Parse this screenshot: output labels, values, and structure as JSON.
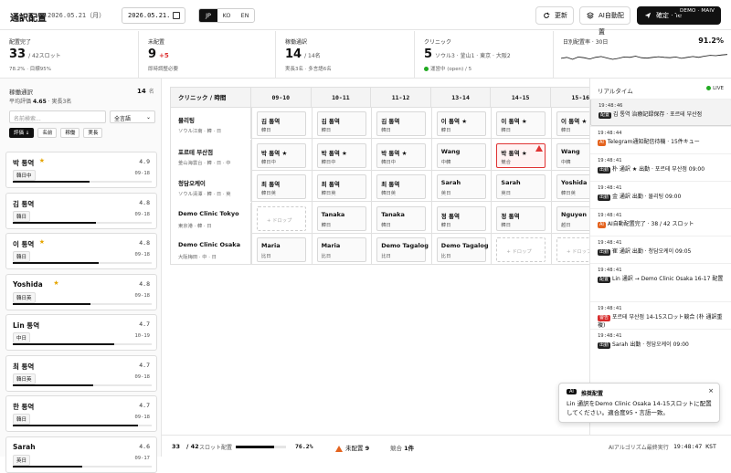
{
  "header": {
    "title": "通訳配置",
    "date_text": "2026.05.21（月）",
    "date_input": "2026.05.21.",
    "langs": [
      "JP",
      "KO",
      "EN"
    ],
    "refresh": "更新",
    "ai_assign": "AI自動配置",
    "confirm": "確定 · Te",
    "demo": "DEMO · MAIV"
  },
  "stats": [
    {
      "label": "配置完了",
      "value": "33",
      "suffix": "/ 42スロット",
      "sub": "78.2% · 目標95%"
    },
    {
      "label": "未配置",
      "value": "9",
      "delta": "+5",
      "sub": "即時調整必要"
    },
    {
      "label": "稼働通訳",
      "value": "14",
      "suffix": "/ 14名",
      "sub": "実長3名 · 多言語6名"
    },
    {
      "label": "クリニック",
      "value": "5",
      "suffix": "ソウル3 · 釜山1 · 東京 · 大阪2",
      "sub": "運営中 (open) / 5"
    },
    {
      "label": "日別配置率 · 30日",
      "value": "91.2%",
      "spark": [
        0.55,
        0.6,
        0.5,
        0.62,
        0.58,
        0.52,
        0.6,
        0.64,
        0.57,
        0.5,
        0.55,
        0.62,
        0.6,
        0.66,
        0.58,
        0.56,
        0.6,
        0.63,
        0.6,
        0.58,
        0.62,
        0.55,
        0.6,
        0.64,
        0.6,
        0.66,
        0.7,
        0.68,
        0.72,
        0.74
      ]
    }
  ],
  "left": {
    "heading": "稼働通訳",
    "count": "14",
    "count_unit": "名",
    "avg_label": "平均評価",
    "avg": "4.65",
    "avg_suffix": "· 実長3名",
    "search_placeholder": "名前検索...",
    "filter": "全言語",
    "sort": [
      "評価",
      "名前",
      "稼働",
      "実長"
    ],
    "interpreters": [
      {
        "name": "박 통역",
        "star": true,
        "score": "4.9",
        "tag": "韓日中",
        "time": "09-18",
        "load": 0.55
      },
      {
        "name": "김 통역",
        "star": false,
        "score": "4.8",
        "tag": "韓日",
        "time": "09-18",
        "load": 0.6
      },
      {
        "name": "이 통역",
        "star": true,
        "score": "4.8",
        "tag": "韓日",
        "time": "09-18",
        "load": 0.62
      },
      {
        "name": "Yoshida",
        "star": true,
        "score": "4.8",
        "tag": "韓日英",
        "time": "09-18",
        "load": 0.56
      },
      {
        "name": "Lin 통역",
        "star": false,
        "score": "4.7",
        "tag": "中日",
        "time": "10-19",
        "load": 0.73
      },
      {
        "name": "최 통역",
        "star": false,
        "score": "4.7",
        "tag": "韓日英",
        "time": "09-18",
        "load": 0.58
      },
      {
        "name": "한 통역",
        "star": false,
        "score": "4.7",
        "tag": "韓日",
        "time": "09-18",
        "load": 0.9
      },
      {
        "name": "Sarah",
        "star": false,
        "score": "4.6",
        "tag": "英日",
        "time": "09-17",
        "load": 0.5
      }
    ]
  },
  "grid": {
    "corner": "クリニック / 時間",
    "slots": [
      "09-10",
      "10-11",
      "11-12",
      "13-14",
      "14-15",
      "15-16"
    ],
    "rows": [
      {
        "name": "뮬리팅",
        "sub": "ソウル江南 · 韓 · 日",
        "cells": [
          [
            "김 통역",
            "韓日"
          ],
          [
            "김 통역",
            "韓日"
          ],
          [
            "김 통역",
            "韓日"
          ],
          [
            "이 통역 ★",
            "韓日"
          ],
          [
            "이 통역 ★",
            "韓日"
          ],
          [
            "이 통역 ★",
            "韓日"
          ]
        ]
      },
      {
        "name": "포르테 부산점",
        "sub": "釜山海雲台 · 韓 · 日 · 中",
        "cells": [
          [
            "박 통역 ★",
            "韓日中"
          ],
          [
            "박 통역 ★",
            "韓日中"
          ],
          [
            "박 통역 ★",
            "韓日中"
          ],
          [
            "Wang",
            "中韓"
          ],
          [
            "박 통역 ★",
            "競合",
            "conf"
          ],
          [
            "Wang",
            "中韓"
          ]
        ]
      },
      {
        "name": "청담오케이",
        "sub": "ソウル清潭 · 韓 · 日 · 英",
        "cells": [
          [
            "최 통역",
            "韓日英"
          ],
          [
            "최 통역",
            "韓日英"
          ],
          [
            "최 통역",
            "韓日英"
          ],
          [
            "Sarah",
            "英日"
          ],
          [
            "Sarah",
            "英日"
          ],
          [
            "Yoshida ★",
            "韓日英"
          ]
        ]
      },
      {
        "name": "Demo Clinic Tokyo",
        "sub": "東京港 · 韓 · 日",
        "cells": [
          [
            "+ ドロップ",
            "",
            "drop"
          ],
          [
            "Tanaka",
            "韓日"
          ],
          [
            "Tanaka",
            "韓日"
          ],
          [
            "정 통역",
            "韓日"
          ],
          [
            "정 통역",
            "韓日"
          ],
          [
            "Nguyen",
            "越日"
          ]
        ]
      },
      {
        "name": "Demo Clinic Osaka",
        "sub": "大阪梅田 · 中 · 日",
        "cells": [
          [
            "Maria",
            "比日"
          ],
          [
            "Maria",
            "比日"
          ],
          [
            "Demo Tagalog",
            "比日"
          ],
          [
            "Demo Tagalog",
            "比日"
          ],
          [
            "+ ドロップ",
            "",
            "drop"
          ],
          [
            "+ ドロップ",
            "",
            "drop"
          ]
        ]
      }
    ]
  },
  "feed": {
    "heading": "リアルタイム",
    "live": "LIVE",
    "events": [
      {
        "time": "19:48:46",
        "badge": "配置",
        "tone": "",
        "text": "김 통역 治療記録保存 · 포르테 부산점",
        "sel": true
      },
      {
        "time": "19:48:44",
        "badge": "AI",
        "tone": "o",
        "text": "Telegram通知配信待機 · 15件キュー"
      },
      {
        "time": "19:48:41",
        "badge": "出勤",
        "tone": "",
        "text": "朴 通訳 ★ 出勤 · 포르테 부산점 09:00"
      },
      {
        "time": "19:48:41",
        "badge": "出勤",
        "tone": "",
        "text": "金 通訳 出勤 · 뮬리팅 09:00"
      },
      {
        "time": "19:48:41",
        "badge": "AI",
        "tone": "o",
        "text": "AI自動配置完了 · 38 / 42 スロット"
      },
      {
        "time": "19:48:41",
        "badge": "出勤",
        "tone": "",
        "text": "崔 通訳 出勤 · 청담오케이 09:05"
      },
      {
        "time": "19:48:41",
        "badge": "配置",
        "tone": "",
        "text": "Lin 通訳 → Demo Clinic Osaka 16-17 配置"
      },
      {
        "time": "19:48:41",
        "badge": "警告",
        "tone": "r",
        "text": "포르테 부산점 14-15スロット競合 (朴 通訳重複)"
      },
      {
        "time": "19:48:41",
        "badge": "出勤",
        "tone": "",
        "text": "Sarah 出勤 · 청담오케이 09:00"
      }
    ]
  },
  "toast": {
    "badge": "AI",
    "title": "推奨配置",
    "text": "Lin 通訳をDemo Clinic Osaka 14-15スロットに配置してください。適合度95・言語一致。"
  },
  "footer": {
    "done": "33",
    "total": "/ 42",
    "slot_label": "スロット配置",
    "progress": 0.762,
    "pct": "76.2%",
    "unassigned_label": "未配置",
    "unassigned": "9",
    "conflict_label": "競合",
    "conflict": "1件",
    "algo": "AIアルゴリズム最終実行",
    "algo_time": "19:48:47 KST"
  }
}
